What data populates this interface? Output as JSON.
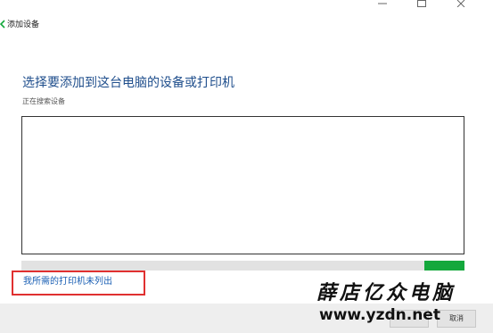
{
  "window": {
    "title": "添加设备"
  },
  "content": {
    "heading": "选择要添加到这台电脑的设备或打印机",
    "status": "正在搜索设备",
    "progress": 0.09
  },
  "links": {
    "printer_not_listed": "我所需的打印机未列出"
  },
  "footer": {
    "cancel_label": "取消"
  },
  "watermark": {
    "brand": "薛店亿众电脑",
    "url": "www.yzdn.net"
  },
  "colors": {
    "heading": "#1f4e8c",
    "link": "#1a5fb4",
    "progress": "#14a83c",
    "highlight": "#e03030"
  }
}
